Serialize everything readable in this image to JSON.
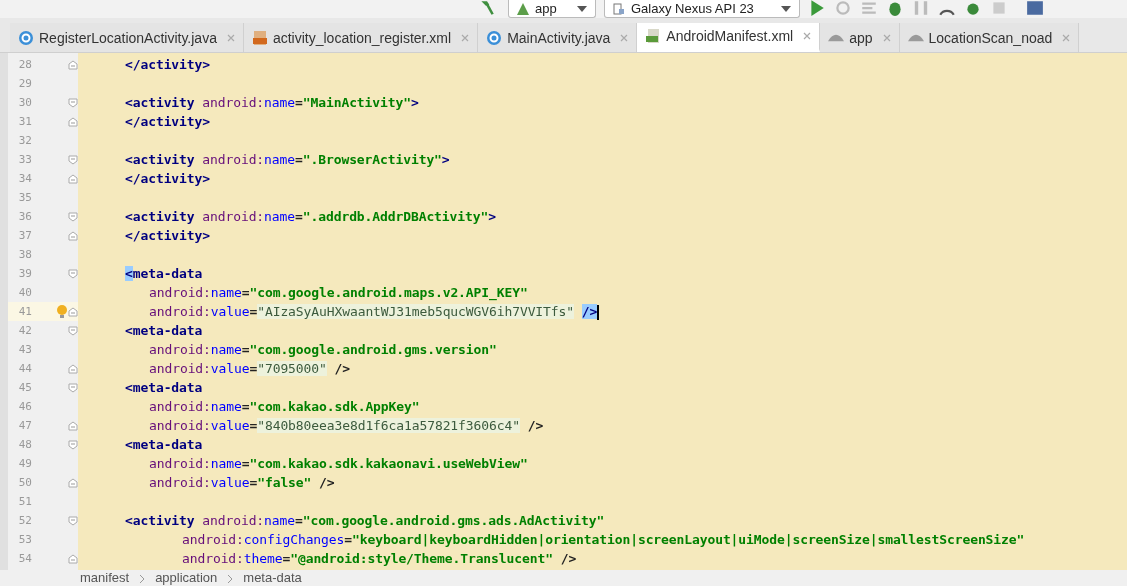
{
  "toolbar": {
    "config": "app",
    "device": "Galaxy Nexus API 23"
  },
  "tabs": [
    {
      "label": "RegisterLocationActivity.java",
      "kind": "class",
      "selected": false
    },
    {
      "label": "activity_location_register.xml",
      "kind": "xml",
      "selected": false
    },
    {
      "label": "MainActivity.java",
      "kind": "class",
      "selected": false
    },
    {
      "label": "AndroidManifest.xml",
      "kind": "manifest",
      "selected": true
    },
    {
      "label": "app",
      "kind": "module",
      "selected": false
    },
    {
      "label": "LocationScan_noad",
      "kind": "module",
      "selected": false
    }
  ],
  "lines": [
    {
      "number": "28",
      "kind": "element",
      "fold_end": true,
      "tokens": [
        {
          "kind": "tag",
          "text": "</activity>"
        }
      ]
    },
    {
      "number": "29"
    },
    {
      "number": "30",
      "kind": "element",
      "fold_start": true,
      "tokens": [
        {
          "kind": "tag",
          "text": "<activity "
        },
        {
          "kind": "ns",
          "text": "android:"
        },
        {
          "kind": "attr",
          "text": "name"
        },
        {
          "kind": "plain",
          "text": "="
        },
        {
          "kind": "str",
          "text": "\"MainActivity\""
        },
        {
          "kind": "tag",
          "text": ">"
        }
      ]
    },
    {
      "number": "31",
      "kind": "element",
      "fold_end": true,
      "tokens": [
        {
          "kind": "tag",
          "text": "</activity>"
        }
      ]
    },
    {
      "number": "32"
    },
    {
      "number": "33",
      "kind": "element",
      "fold_start": true,
      "tokens": [
        {
          "kind": "tag",
          "text": "<activity "
        },
        {
          "kind": "ns",
          "text": "android:"
        },
        {
          "kind": "attr",
          "text": "name"
        },
        {
          "kind": "plain",
          "text": "="
        },
        {
          "kind": "str",
          "text": "\".BrowserActivity\""
        },
        {
          "kind": "tag",
          "text": ">"
        }
      ]
    },
    {
      "number": "34",
      "kind": "element",
      "fold_end": true,
      "tokens": [
        {
          "kind": "tag",
          "text": "</activity>"
        }
      ]
    },
    {
      "number": "35"
    },
    {
      "number": "36",
      "kind": "element",
      "fold_start": true,
      "tokens": [
        {
          "kind": "tag",
          "text": "<activity "
        },
        {
          "kind": "ns",
          "text": "android:"
        },
        {
          "kind": "attr",
          "text": "name"
        },
        {
          "kind": "plain",
          "text": "="
        },
        {
          "kind": "str",
          "text": "\".addrdb.AddrDBActivity\""
        },
        {
          "kind": "tag",
          "text": ">"
        }
      ]
    },
    {
      "number": "37",
      "kind": "element",
      "fold_end": true,
      "tokens": [
        {
          "kind": "tag",
          "text": "</activity>"
        }
      ]
    },
    {
      "number": "38"
    },
    {
      "number": "39",
      "kind": "element",
      "fold_start": true,
      "tokens": [
        {
          "kind": "match",
          "text": "<"
        },
        {
          "kind": "tag",
          "text": "meta-data"
        }
      ]
    },
    {
      "number": "40",
      "kind": "attribute",
      "tokens": [
        {
          "kind": "ns",
          "text": "android:"
        },
        {
          "kind": "attr",
          "text": "name"
        },
        {
          "kind": "plain",
          "text": "="
        },
        {
          "kind": "str",
          "text": "\"com.google.android.maps.v2.API_KEY\""
        }
      ]
    },
    {
      "number": "41",
      "kind": "attribute",
      "fold_end": true,
      "current": true,
      "bulb": true,
      "tokens": [
        {
          "kind": "ns",
          "text": "android:"
        },
        {
          "kind": "attr",
          "text": "value"
        },
        {
          "kind": "plain",
          "text": "="
        },
        {
          "kind": "val",
          "text": "\"AIzaSyAuHXwaantWJ31meb5qucWGV6ih7VVITfs\""
        },
        {
          "kind": "match",
          "text": "/>"
        },
        {
          "kind": "caret"
        }
      ]
    },
    {
      "number": "42",
      "kind": "element",
      "fold_start": true,
      "tokens": [
        {
          "kind": "tag",
          "text": "<meta-data"
        }
      ]
    },
    {
      "number": "43",
      "kind": "attribute",
      "tokens": [
        {
          "kind": "ns",
          "text": "android:"
        },
        {
          "kind": "attr",
          "text": "name"
        },
        {
          "kind": "plain",
          "text": "="
        },
        {
          "kind": "str",
          "text": "\"com.google.android.gms.version\""
        }
      ]
    },
    {
      "number": "44",
      "kind": "attribute",
      "fold_end": true,
      "tokens": [
        {
          "kind": "ns",
          "text": "android:"
        },
        {
          "kind": "attr",
          "text": "value"
        },
        {
          "kind": "plain",
          "text": "="
        },
        {
          "kind": "val",
          "text": "\"7095000\""
        },
        {
          "kind": "plain",
          "text": " />"
        }
      ]
    },
    {
      "number": "45",
      "kind": "element",
      "fold_start": true,
      "tokens": [
        {
          "kind": "tag",
          "text": "<meta-data"
        }
      ]
    },
    {
      "number": "46",
      "kind": "attribute",
      "tokens": [
        {
          "kind": "ns",
          "text": "android:"
        },
        {
          "kind": "attr",
          "text": "name"
        },
        {
          "kind": "plain",
          "text": "="
        },
        {
          "kind": "str",
          "text": "\"com.kakao.sdk.AppKey\""
        }
      ]
    },
    {
      "number": "47",
      "kind": "attribute",
      "fold_end": true,
      "tokens": [
        {
          "kind": "ns",
          "text": "android:"
        },
        {
          "kind": "attr",
          "text": "value"
        },
        {
          "kind": "plain",
          "text": "="
        },
        {
          "kind": "val",
          "text": "\"840b80eea3e8d1f6ca1a57821f3606c4\""
        },
        {
          "kind": "plain",
          "text": " />"
        }
      ]
    },
    {
      "number": "48",
      "kind": "element",
      "fold_start": true,
      "tokens": [
        {
          "kind": "tag",
          "text": "<meta-data"
        }
      ]
    },
    {
      "number": "49",
      "kind": "attribute",
      "tokens": [
        {
          "kind": "ns",
          "text": "android:"
        },
        {
          "kind": "attr",
          "text": "name"
        },
        {
          "kind": "plain",
          "text": "="
        },
        {
          "kind": "str",
          "text": "\"com.kakao.sdk.kakaonavi.useWebView\""
        }
      ]
    },
    {
      "number": "50",
      "kind": "attribute",
      "fold_end": true,
      "tokens": [
        {
          "kind": "ns",
          "text": "android:"
        },
        {
          "kind": "attr",
          "text": "value"
        },
        {
          "kind": "plain",
          "text": "="
        },
        {
          "kind": "str",
          "text": "\"false\""
        },
        {
          "kind": "plain",
          "text": " />"
        }
      ]
    },
    {
      "number": "51"
    },
    {
      "number": "52",
      "kind": "element",
      "fold_start": true,
      "tokens": [
        {
          "kind": "tag",
          "text": "<activity "
        },
        {
          "kind": "ns",
          "text": "android:"
        },
        {
          "kind": "attr",
          "text": "name"
        },
        {
          "kind": "plain",
          "text": "="
        },
        {
          "kind": "str",
          "text": "\"com.google.android.gms.ads.AdActivity\""
        }
      ]
    },
    {
      "number": "53",
      "kind": "continuation",
      "tokens": [
        {
          "kind": "ns",
          "text": "android:"
        },
        {
          "kind": "attr",
          "text": "configChanges"
        },
        {
          "kind": "plain",
          "text": "="
        },
        {
          "kind": "str",
          "text": "\"keyboard|keyboardHidden|orientation|screenLayout|uiMode|screenSize|smallestScreenSize\""
        }
      ]
    },
    {
      "number": "54",
      "kind": "continuation",
      "fold_end": true,
      "tokens": [
        {
          "kind": "ns",
          "text": "android:"
        },
        {
          "kind": "attr",
          "text": "theme"
        },
        {
          "kind": "plain",
          "text": "="
        },
        {
          "kind": "str",
          "text": "\"@android:style/Theme.Translucent\""
        },
        {
          "kind": "plain",
          "text": " />"
        }
      ]
    }
  ],
  "breadcrumbs": [
    "manifest",
    "application",
    "meta-data"
  ]
}
